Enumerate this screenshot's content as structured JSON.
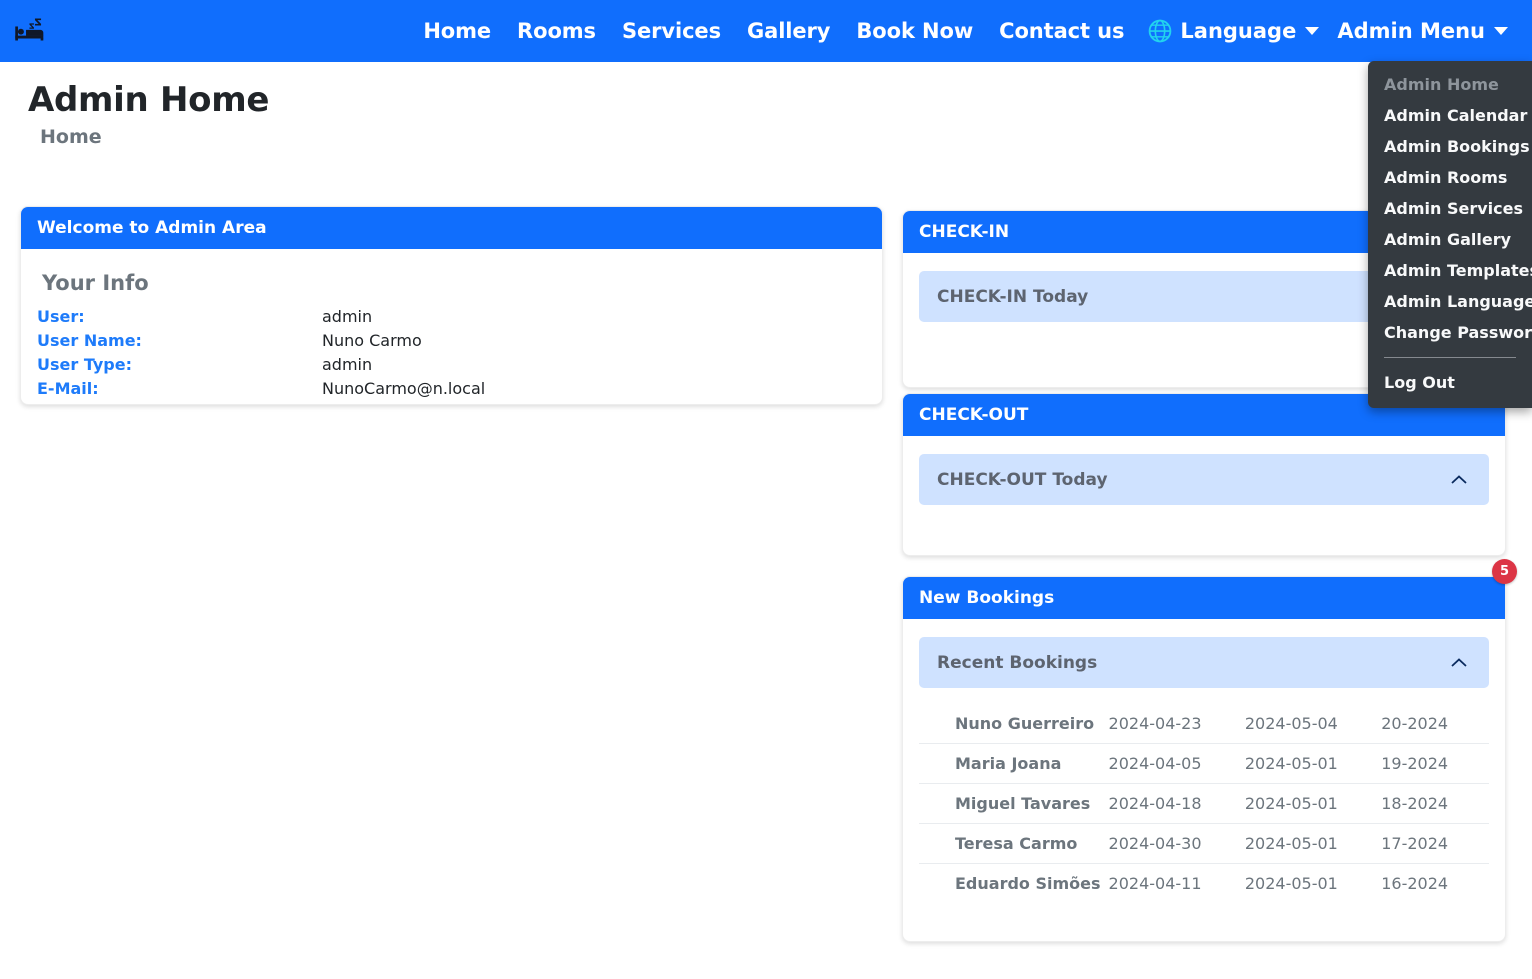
{
  "navbar": {
    "brand_icon": "hotel-bed-icon",
    "links": [
      {
        "label": "Home"
      },
      {
        "label": "Rooms"
      },
      {
        "label": "Services"
      },
      {
        "label": "Gallery"
      },
      {
        "label": "Book Now"
      },
      {
        "label": "Contact us"
      }
    ],
    "language_dropdown": {
      "label": "Language",
      "icon": "globe-icon"
    },
    "admin_dropdown": {
      "label": "Admin Menu"
    },
    "background_color": "#106efd"
  },
  "admin_menu": {
    "items": [
      {
        "label": "Admin Home",
        "disabled": true
      },
      {
        "label": "Admin Calendar",
        "disabled": false
      },
      {
        "label": "Admin Bookings",
        "disabled": false
      },
      {
        "label": "Admin Rooms",
        "disabled": false
      },
      {
        "label": "Admin Services",
        "disabled": false
      },
      {
        "label": "Admin Gallery",
        "disabled": false
      },
      {
        "label": "Admin Templates",
        "disabled": false
      },
      {
        "label": "Admin Language",
        "disabled": false
      },
      {
        "label": "Change Password",
        "disabled": false
      }
    ],
    "logout_label": "Log Out",
    "background_color": "#343a40"
  },
  "page": {
    "title": "Admin Home",
    "breadcrumb": "Home"
  },
  "welcome_card": {
    "header": "Welcome to Admin Area",
    "section_title": "Your Info",
    "rows": [
      {
        "label": "User:",
        "value": "admin"
      },
      {
        "label": "User Name:",
        "value": "Nuno Carmo"
      },
      {
        "label": "User Type:",
        "value": "admin"
      },
      {
        "label": "E-Mail:",
        "value": "NunoCarmo@n.local"
      }
    ]
  },
  "checkin_card": {
    "header": "CHECK-IN",
    "accordion_title": "CHECK-IN Today",
    "chevron": "chevron-up-icon"
  },
  "checkout_card": {
    "header": "CHECK-OUT",
    "accordion_title": "CHECK-OUT Today",
    "chevron": "chevron-up-icon"
  },
  "bookings_card": {
    "header": "New Bookings",
    "badge": "5",
    "badge_color": "#dc3545",
    "accordion_title": "Recent Bookings",
    "chevron": "chevron-up-icon",
    "rows": [
      {
        "name": "Nuno Guerreiro",
        "from": "2024-04-23",
        "to": "2024-05-04",
        "ref": "20-2024"
      },
      {
        "name": "Maria Joana",
        "from": "2024-04-05",
        "to": "2024-05-01",
        "ref": "19-2024"
      },
      {
        "name": "Miguel Tavares",
        "from": "2024-04-18",
        "to": "2024-05-01",
        "ref": "18-2024"
      },
      {
        "name": "Teresa Carmo",
        "from": "2024-04-30",
        "to": "2024-05-01",
        "ref": "17-2024"
      },
      {
        "name": "Eduardo Simões",
        "from": "2024-04-11",
        "to": "2024-05-01",
        "ref": "16-2024"
      }
    ]
  }
}
